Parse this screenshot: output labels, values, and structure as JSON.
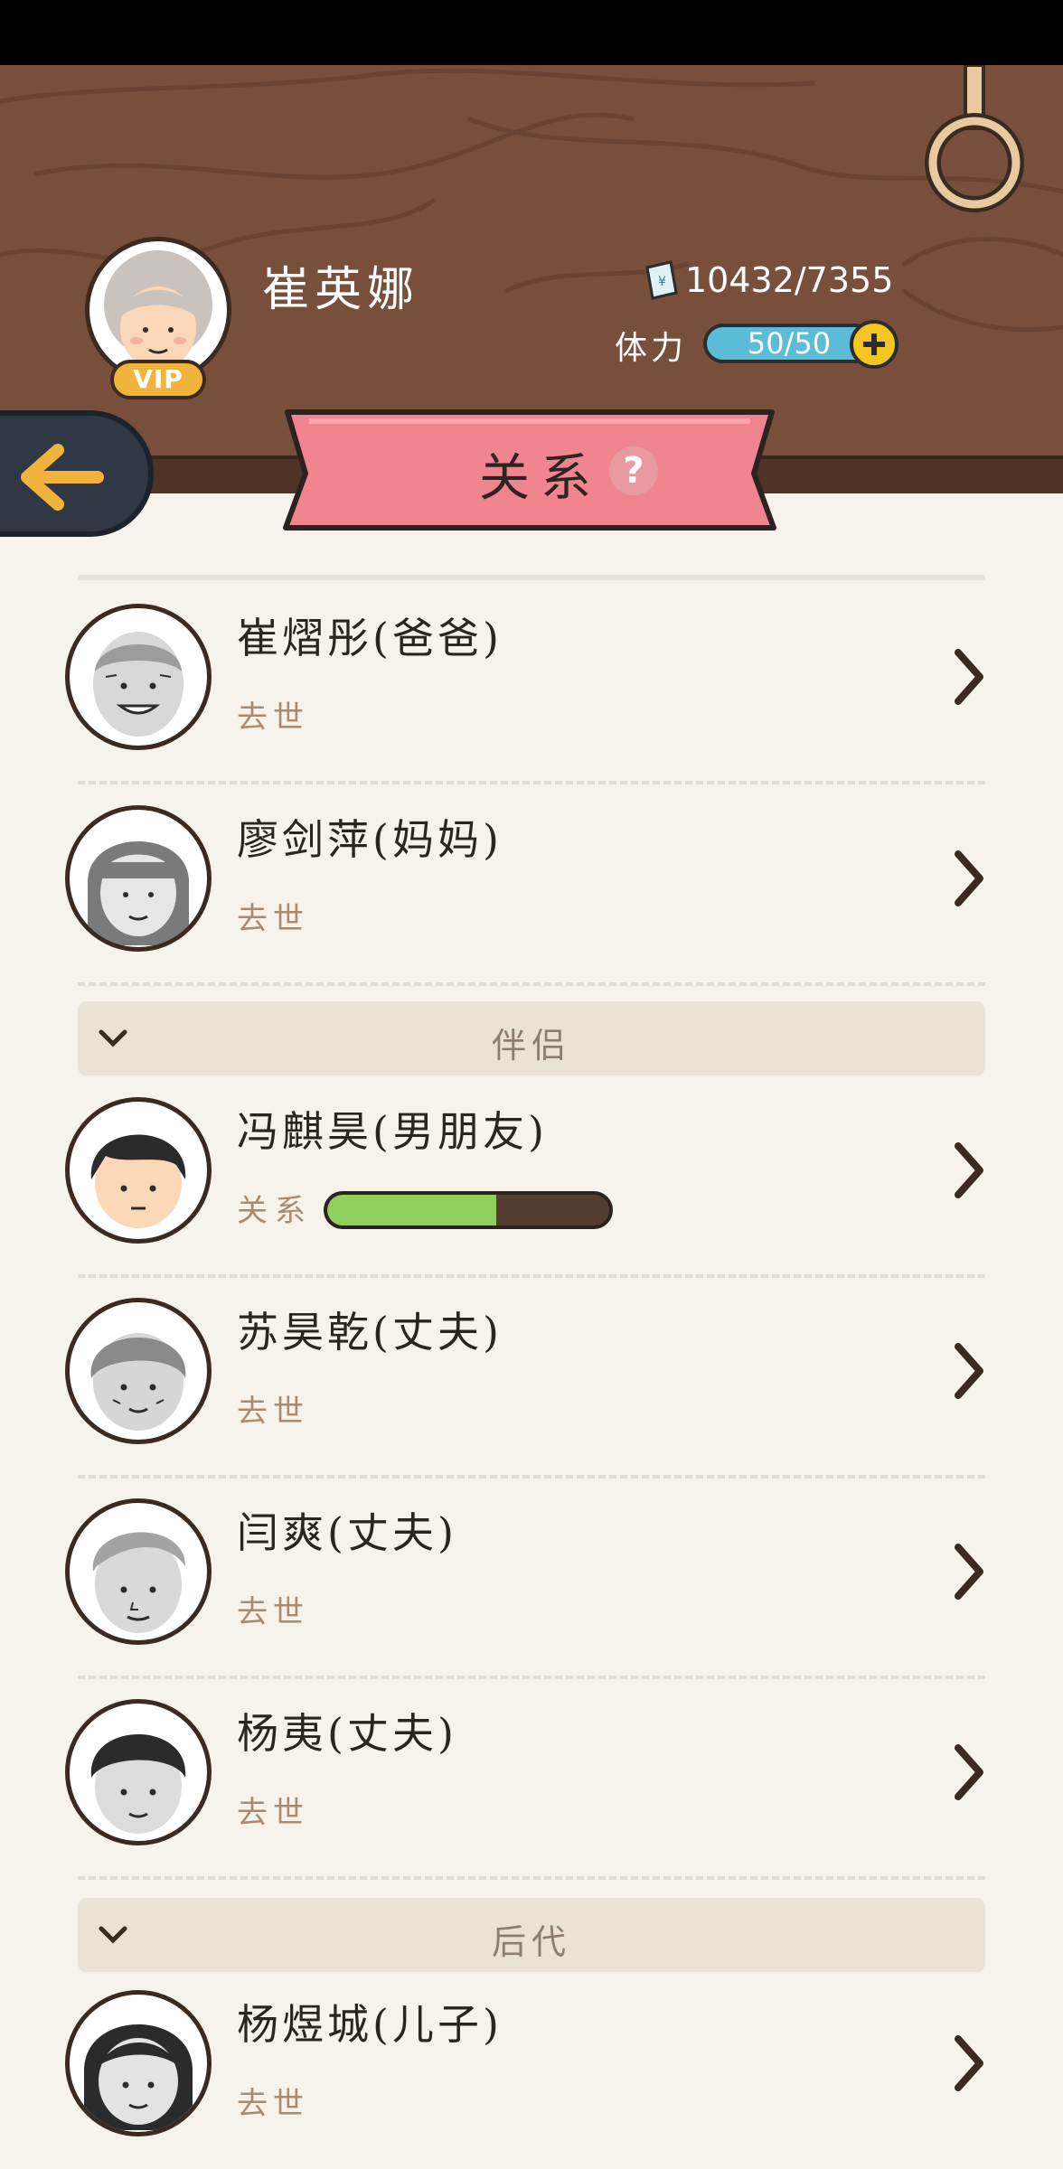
{
  "player": {
    "name": "崔英娜",
    "vip_label": "VIP",
    "money": "10432/7355",
    "stamina_label": "体力",
    "stamina_value": "50/50"
  },
  "page": {
    "title": "关系",
    "help_icon": "?"
  },
  "relations": {
    "parents": [
      {
        "name": "崔熠彤(爸爸)",
        "status": "去世",
        "avatar": "elder-man-face"
      },
      {
        "name": "廖剑萍(妈妈)",
        "status": "去世",
        "avatar": "elder-woman-face"
      }
    ],
    "partners_section": "伴侣",
    "partners": [
      {
        "name": "冯麒昊(男朋友)",
        "status_label": "关系",
        "relationship_level": 0.6,
        "avatar": "young-man-face"
      },
      {
        "name": "苏昊乾(丈夫)",
        "status": "去世",
        "avatar": "elder-man-face"
      },
      {
        "name": "闫爽(丈夫)",
        "status": "去世",
        "avatar": "elder-man-face"
      },
      {
        "name": "杨夷(丈夫)",
        "status": "去世",
        "avatar": "man-face"
      }
    ],
    "descendants_section": "后代",
    "descendants": [
      {
        "name": "杨煜城(儿子)",
        "status": "去世",
        "avatar": "woman-face"
      }
    ]
  },
  "colors": {
    "header_wood": "#774f3b",
    "banner_pink": "#f08590",
    "relationship_green": "#8fcf5c",
    "stamina_blue": "#5bbcd8",
    "background": "#f7f3ea"
  }
}
